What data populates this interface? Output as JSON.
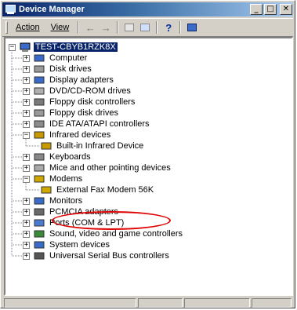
{
  "window": {
    "title": "Device Manager"
  },
  "menu": {
    "action": "Action",
    "view": "View"
  },
  "toolbar": {
    "icons": [
      "back-arrow-icon",
      "forward-arrow-icon",
      "grid-icon",
      "properties-icon",
      "help-icon",
      "monitor-icon"
    ]
  },
  "tree": {
    "root": "TEST-CBYB1RZK8X",
    "items": [
      {
        "label": "Computer",
        "icon": "computer-icon",
        "expanded": false
      },
      {
        "label": "Disk drives",
        "icon": "disk-drive-icon",
        "expanded": false
      },
      {
        "label": "Display adapters",
        "icon": "display-adapter-icon",
        "expanded": false
      },
      {
        "label": "DVD/CD-ROM drives",
        "icon": "cdrom-icon",
        "expanded": false
      },
      {
        "label": "Floppy disk controllers",
        "icon": "floppy-controller-icon",
        "expanded": false
      },
      {
        "label": "Floppy disk drives",
        "icon": "floppy-drive-icon",
        "expanded": false
      },
      {
        "label": "IDE ATA/ATAPI controllers",
        "icon": "ide-controller-icon",
        "expanded": false
      },
      {
        "label": "Infrared devices",
        "icon": "infrared-icon",
        "expanded": true,
        "children": [
          "Built-in Infrared Device"
        ]
      },
      {
        "label": "Keyboards",
        "icon": "keyboard-icon",
        "expanded": false
      },
      {
        "label": "Mice and other pointing devices",
        "icon": "mouse-icon",
        "expanded": false
      },
      {
        "label": "Modems",
        "icon": "modem-icon",
        "expanded": true,
        "children": [
          "External Fax Modem 56K"
        ]
      },
      {
        "label": "Monitors",
        "icon": "monitor-icon",
        "expanded": false
      },
      {
        "label": "PCMCIA adapters",
        "icon": "pcmcia-icon",
        "expanded": false
      },
      {
        "label": "Ports (COM & LPT)",
        "icon": "port-icon",
        "expanded": false
      },
      {
        "label": "Sound, video and game controllers",
        "icon": "sound-icon",
        "expanded": false
      },
      {
        "label": "System devices",
        "icon": "system-icon",
        "expanded": false
      },
      {
        "label": "Universal Serial Bus controllers",
        "icon": "usb-icon",
        "expanded": false
      }
    ]
  },
  "annotation": {
    "color": "#e00000"
  }
}
